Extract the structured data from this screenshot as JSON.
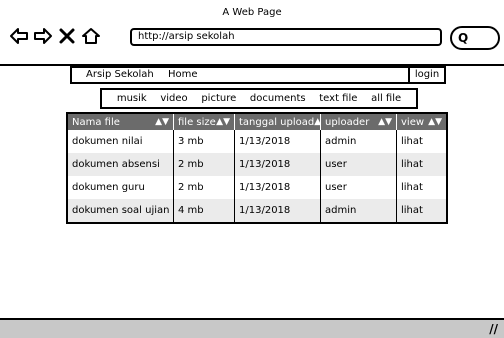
{
  "window": {
    "title": "A Web Page"
  },
  "browser": {
    "back_icon": "left-arrow-icon",
    "forward_icon": "right-arrow-icon",
    "stop_icon": "close-icon",
    "home_icon": "home-icon",
    "url": "http://arsip sekolah",
    "search_icon": "search-icon"
  },
  "topnav": {
    "brand": "Arsip Sekolah",
    "home": "Home",
    "login": "login"
  },
  "filters": [
    "musik",
    "video",
    "picture",
    "documents",
    "text file",
    "all file"
  ],
  "table": {
    "columns": [
      "Nama file",
      "file size",
      "tanggal upload",
      "uploader",
      "view"
    ],
    "rows": [
      [
        "dokumen nilai",
        "3 mb",
        "1/13/2018",
        "admin",
        "lihat"
      ],
      [
        "dokumen absensi",
        "2 mb",
        "1/13/2018",
        "user",
        "lihat"
      ],
      [
        "dokumen guru",
        "2 mb",
        "1/13/2018",
        "user",
        "lihat"
      ],
      [
        "dokumen soal ujian",
        "4 mb",
        "1/13/2018",
        "admin",
        "lihat"
      ]
    ]
  },
  "statusbar": {
    "resize_icon": "resize-grip-icon"
  }
}
